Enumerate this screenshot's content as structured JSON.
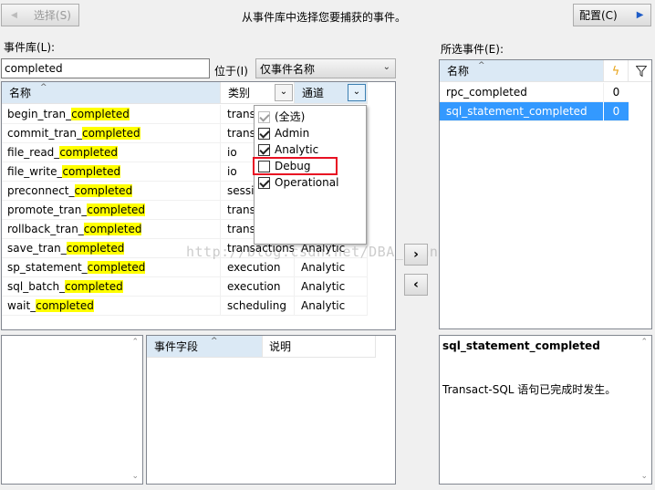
{
  "toolbar": {
    "select_button": "选择(S)",
    "title": "从事件库中选择您要捕获的事件。",
    "config_button": "配置(C)"
  },
  "library": {
    "label": "事件库(L):",
    "search_value": "completed",
    "location_label": "位于(I)",
    "scope_value": "仅事件名称",
    "headers": {
      "name": "名称",
      "category": "类别",
      "channel": "通道"
    },
    "rows": [
      {
        "pre": "begin_tran_",
        "hl": "completed",
        "category": "trans",
        "channel": ""
      },
      {
        "pre": "commit_tran_",
        "hl": "completed",
        "category": "trans",
        "channel": ""
      },
      {
        "pre": "file_read_",
        "hl": "completed",
        "category": "io",
        "channel": ""
      },
      {
        "pre": "file_write_",
        "hl": "completed",
        "category": "io",
        "channel": ""
      },
      {
        "pre": "preconnect_",
        "hl": "completed",
        "category": "sessi",
        "channel": ""
      },
      {
        "pre": "promote_tran_",
        "hl": "completed",
        "category": "trans",
        "channel": ""
      },
      {
        "pre": "rollback_tran_",
        "hl": "completed",
        "category": "trans",
        "channel": ""
      },
      {
        "pre": "save_tran_",
        "hl": "completed",
        "category": "transactions",
        "channel": "Analytic"
      },
      {
        "pre": "sp_statement_",
        "hl": "completed",
        "category": "execution",
        "channel": "Analytic"
      },
      {
        "pre": "sql_batch_",
        "hl": "completed",
        "category": "execution",
        "channel": "Analytic"
      },
      {
        "pre": "wait_",
        "hl": "completed",
        "category": "scheduling",
        "channel": "Analytic"
      }
    ]
  },
  "channel_filter": {
    "items": [
      {
        "label": "(全选)",
        "checked": true,
        "grey": true
      },
      {
        "label": "Admin",
        "checked": true,
        "grey": false
      },
      {
        "label": "Analytic",
        "checked": true,
        "grey": false
      },
      {
        "label": "Debug",
        "checked": false,
        "grey": false
      },
      {
        "label": "Operational",
        "checked": true,
        "grey": false
      }
    ],
    "highlight_color": "#e81123"
  },
  "watermark": "http://blog.csdn.net/DBA_Huangzj",
  "selected": {
    "label": "所选事件(E):",
    "headers": {
      "name": "名称"
    },
    "rows": [
      {
        "name": "rpc_completed",
        "count": "0"
      },
      {
        "name": "sql_statement_completed",
        "count": "0"
      }
    ],
    "selection_color": "#3399ff"
  },
  "fields": {
    "headers": {
      "field": "事件字段",
      "desc": "说明"
    }
  },
  "details": {
    "title": "sql_statement_completed",
    "description": "Transact-SQL 语句已完成时发生。"
  }
}
